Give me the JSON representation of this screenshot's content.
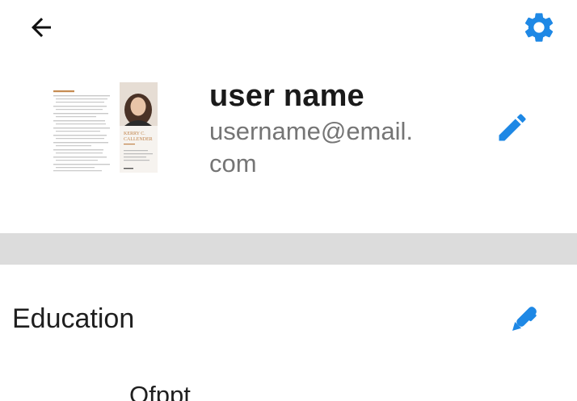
{
  "header": {
    "back_icon": "arrow-left-icon",
    "settings_icon": "gear-icon"
  },
  "profile": {
    "name": "user name",
    "email": "username@email.com",
    "edit_icon": "pencil-icon",
    "avatar": {
      "doc_name": "KERRY C. CALLENDER"
    }
  },
  "education": {
    "title": "Education",
    "edit_icon": "pen-icon",
    "items": [
      "Ofppt"
    ]
  },
  "colors": {
    "accent": "#1e88e5",
    "divider": "#dcdcdc",
    "text_primary": "#1a1a1a",
    "text_secondary": "#757575"
  }
}
